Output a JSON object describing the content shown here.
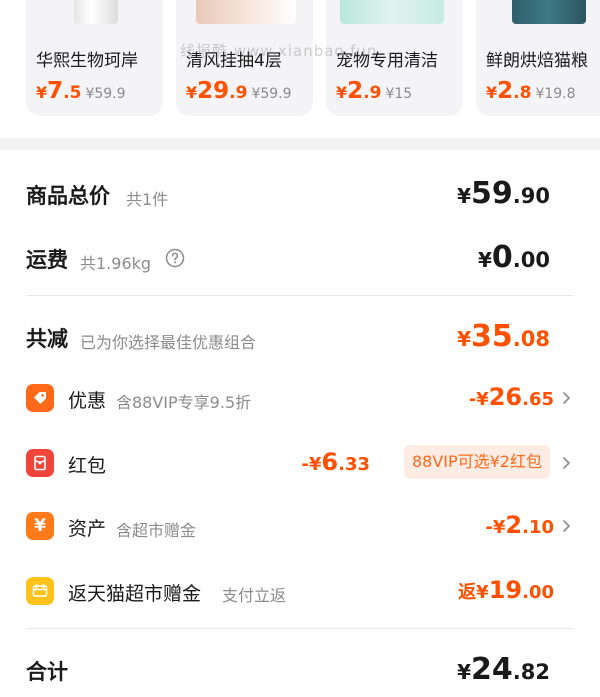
{
  "recommendations": [
    {
      "name": "华熙生物珂岸",
      "currency": "¥",
      "price_int": "7",
      "price_dec": ".5",
      "original": "¥59.9"
    },
    {
      "name": "清风挂抽4层",
      "currency": "¥",
      "price_int": "29",
      "price_dec": ".9",
      "original": "¥59.9"
    },
    {
      "name": "宠物专用清洁",
      "currency": "¥",
      "price_int": "2",
      "price_dec": ".9",
      "original": "¥15"
    },
    {
      "name": "鲜朗烘焙猫粮",
      "currency": "¥",
      "price_int": "2",
      "price_dec": ".8",
      "original": "¥19.8"
    }
  ],
  "watermark": "线报酷 www.xianbao.fun",
  "summary": {
    "goods_total": {
      "label": "商品总价",
      "sub": "共1件",
      "currency": "¥",
      "int": "59",
      "dec": ".90"
    },
    "shipping": {
      "label": "运费",
      "sub": "共1.96kg",
      "currency": "¥",
      "int": "0",
      "dec": ".00"
    },
    "total_discount": {
      "label": "共减",
      "sub": "已为你选择最佳优惠组合",
      "currency": "¥",
      "int": "35",
      "dec": ".08"
    },
    "discount_items": [
      {
        "label": "优惠",
        "sub": "含88VIP专享9.5折",
        "prefix": "-¥",
        "int": "26",
        "dec": ".65",
        "icon": "tag-icon"
      },
      {
        "label": "红包",
        "sub": "",
        "prefix": "-¥",
        "int": "6",
        "dec": ".33",
        "chip": "88VIP可选¥2红包",
        "icon": "red-packet-icon"
      },
      {
        "label": "资产",
        "sub": "含超市赠金",
        "prefix": "-¥",
        "int": "2",
        "dec": ".10",
        "icon": "yen-asset-icon"
      },
      {
        "label": "返天猫超市赠金",
        "sub": "支付立返",
        "prefix": "返¥",
        "int": "19",
        "dec": ".00",
        "icon": "wallet-icon"
      }
    ],
    "grand_total": {
      "label": "合计",
      "currency": "¥",
      "int": "24",
      "dec": ".82"
    }
  },
  "colors": {
    "accent": "#ff5000",
    "tag_icon": "#ff6a1a",
    "red_packet_icon": "#f0453a",
    "asset_icon": "#ff7a1a",
    "wallet_icon": "#ffc21a"
  }
}
